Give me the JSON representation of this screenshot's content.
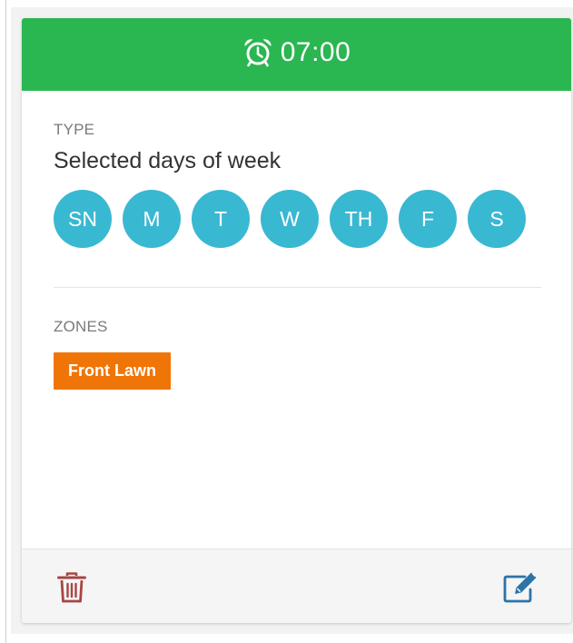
{
  "colors": {
    "header_bg": "#2ab650",
    "day_bg": "#39b8d2",
    "zone_bg": "#f07507",
    "trash": "#a84545",
    "edit": "#2b74a8"
  },
  "header": {
    "icon": "alarm-clock-icon",
    "time": "07:00"
  },
  "type_section": {
    "label": "TYPE",
    "value": "Selected days of week",
    "days": [
      "SN",
      "M",
      "T",
      "W",
      "TH",
      "F",
      "S"
    ]
  },
  "zones_section": {
    "label": "ZONES",
    "zones": [
      "Front Lawn"
    ]
  },
  "footer": {
    "delete_icon": "trash-icon",
    "edit_icon": "edit-icon"
  }
}
